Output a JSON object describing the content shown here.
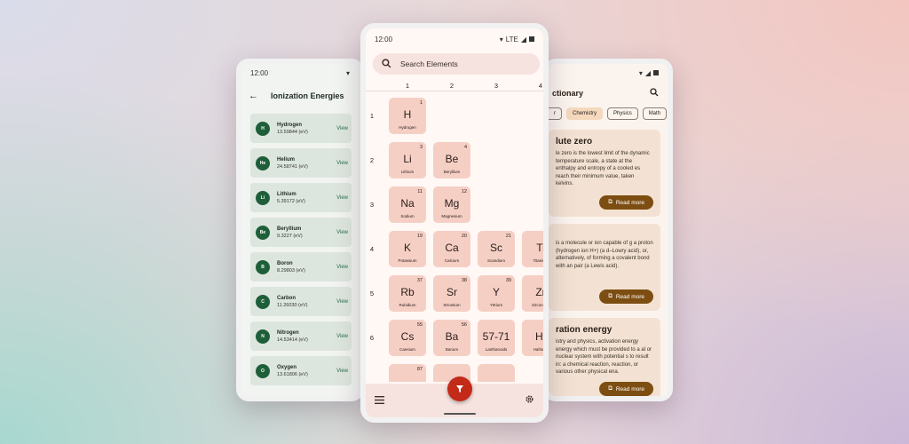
{
  "left": {
    "status_time": "12:00",
    "title": "Ionization Energies",
    "view_label": "View",
    "items": [
      {
        "badge": "H",
        "name": "Hydrogen",
        "value": "13.59844 (eV)"
      },
      {
        "badge": "He",
        "name": "Helium",
        "value": "24.58741 (eV)"
      },
      {
        "badge": "Li",
        "name": "Lithium",
        "value": "5.39172 (eV)"
      },
      {
        "badge": "Be",
        "name": "Beryllium",
        "value": "9.3227 (eV)"
      },
      {
        "badge": "B",
        "name": "Boron",
        "value": "8.29803 (eV)"
      },
      {
        "badge": "C",
        "name": "Carbon",
        "value": "11.26030 (eV)"
      },
      {
        "badge": "N",
        "name": "Nitrogen",
        "value": "14.53414 (eV)"
      },
      {
        "badge": "O",
        "name": "Oxygen",
        "value": "13.61806 (eV)"
      }
    ]
  },
  "center": {
    "status_time": "12:00",
    "status_network": "LTE",
    "search_placeholder": "Search Elements",
    "columns": [
      "1",
      "2",
      "3",
      "4"
    ],
    "rows": [
      "1",
      "2",
      "3",
      "4",
      "5",
      "6"
    ],
    "elements": [
      {
        "num": "1",
        "sym": "H",
        "name": "Hydrogen"
      },
      {
        "num": "3",
        "sym": "Li",
        "name": "Lithium"
      },
      {
        "num": "4",
        "sym": "Be",
        "name": "Beryllium"
      },
      {
        "num": "11",
        "sym": "Na",
        "name": "Sodium"
      },
      {
        "num": "12",
        "sym": "Mg",
        "name": "Magnesium"
      },
      {
        "num": "19",
        "sym": "K",
        "name": "Potassium"
      },
      {
        "num": "20",
        "sym": "Ca",
        "name": "Calcium"
      },
      {
        "num": "21",
        "sym": "Sc",
        "name": "Scandium"
      },
      {
        "num": "",
        "sym": "Ti",
        "name": "Titanium"
      },
      {
        "num": "37",
        "sym": "Rb",
        "name": "Rubidium"
      },
      {
        "num": "38",
        "sym": "Sr",
        "name": "Strontium"
      },
      {
        "num": "39",
        "sym": "Y",
        "name": "Yttrium"
      },
      {
        "num": "",
        "sym": "Zr",
        "name": "Zirconium"
      },
      {
        "num": "55",
        "sym": "Cs",
        "name": "Caesium"
      },
      {
        "num": "56",
        "sym": "Ba",
        "name": "Barium"
      },
      {
        "num": "",
        "sym": "57-71",
        "name": "Lanthanoids"
      },
      {
        "num": "",
        "sym": "Hf",
        "name": "Hafnium"
      },
      {
        "num": "87",
        "sym": "",
        "name": ""
      },
      {
        "num": "",
        "sym": "",
        "name": ""
      },
      {
        "num": "",
        "sym": "",
        "name": ""
      }
    ]
  },
  "right": {
    "title": "ctionary",
    "chips": [
      "r",
      "Chemistry",
      "Physics",
      "Math"
    ],
    "active_chip": "Chemistry",
    "read_more": "Read more",
    "cards": [
      {
        "title": "lute zero",
        "body": "le zero is the lowest limit of the dynamic temperature scale, a state at the enthalpy and entropy of a cooled es reach their minimum value, taken kelvins."
      },
      {
        "title": "",
        "body": "is a molecule or ion capable of g a proton (hydrogen ion H+) (a d–Lowry acid), or, alternatively, of forming a covalent bond with an pair (a Lewis acid)."
      },
      {
        "title": "ration energy",
        "body": "istry and physics, activation energy energy which must be provided to a al or nuclear system with potential s to result in: a chemical reaction, reaction, or various other physical ena."
      }
    ]
  }
}
